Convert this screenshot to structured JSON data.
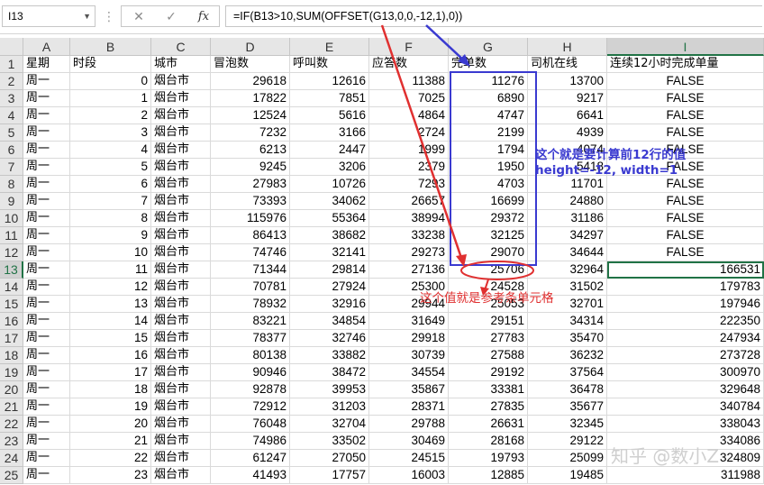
{
  "formula_bar": {
    "name_box": "I13",
    "cancel_glyph": "✕",
    "enter_glyph": "✓",
    "fx_label": "fx",
    "formula": "=IF(B13>10,SUM(OFFSET(G13,0,0,-12,1),0))"
  },
  "columns": [
    "A",
    "B",
    "C",
    "D",
    "E",
    "F",
    "G",
    "H",
    "I"
  ],
  "selected_column": "I",
  "header_row": [
    "星期",
    "时段",
    "城市",
    "冒泡数",
    "呼叫数",
    "应答数",
    "完单数",
    "司机在线",
    "连续12小时完成单量"
  ],
  "rows": [
    [
      "周一",
      "0",
      "烟台市",
      "29618",
      "12616",
      "11388",
      "11276",
      "13700",
      "FALSE"
    ],
    [
      "周一",
      "1",
      "烟台市",
      "17822",
      "7851",
      "7025",
      "6890",
      "9217",
      "FALSE"
    ],
    [
      "周一",
      "2",
      "烟台市",
      "12524",
      "5616",
      "4864",
      "4747",
      "6641",
      "FALSE"
    ],
    [
      "周一",
      "3",
      "烟台市",
      "7232",
      "3166",
      "2724",
      "2199",
      "4939",
      "FALSE"
    ],
    [
      "周一",
      "4",
      "烟台市",
      "6213",
      "2447",
      "1999",
      "1794",
      "4074",
      "FALSE"
    ],
    [
      "周一",
      "5",
      "烟台市",
      "9245",
      "3206",
      "2379",
      "1950",
      "5418",
      "FALSE"
    ],
    [
      "周一",
      "6",
      "烟台市",
      "27983",
      "10726",
      "7293",
      "4703",
      "11701",
      "FALSE"
    ],
    [
      "周一",
      "7",
      "烟台市",
      "73393",
      "34062",
      "26657",
      "16699",
      "24880",
      "FALSE"
    ],
    [
      "周一",
      "8",
      "烟台市",
      "115976",
      "55364",
      "38994",
      "29372",
      "31186",
      "FALSE"
    ],
    [
      "周一",
      "9",
      "烟台市",
      "86413",
      "38682",
      "33238",
      "32125",
      "34297",
      "FALSE"
    ],
    [
      "周一",
      "10",
      "烟台市",
      "74746",
      "32141",
      "29273",
      "29070",
      "34644",
      "FALSE"
    ],
    [
      "周一",
      "11",
      "烟台市",
      "71344",
      "29814",
      "27136",
      "25706",
      "32964",
      "166531"
    ],
    [
      "周一",
      "12",
      "烟台市",
      "70781",
      "27924",
      "25300",
      "24528",
      "31502",
      "179783"
    ],
    [
      "周一",
      "13",
      "烟台市",
      "78932",
      "32916",
      "29944",
      "25053",
      "32701",
      "197946"
    ],
    [
      "周一",
      "14",
      "烟台市",
      "83221",
      "34854",
      "31649",
      "29151",
      "34314",
      "222350"
    ],
    [
      "周一",
      "15",
      "烟台市",
      "78377",
      "32746",
      "29918",
      "27783",
      "35470",
      "247934"
    ],
    [
      "周一",
      "16",
      "烟台市",
      "80138",
      "33882",
      "30739",
      "27588",
      "36232",
      "273728"
    ],
    [
      "周一",
      "17",
      "烟台市",
      "90946",
      "38472",
      "34554",
      "29192",
      "37564",
      "300970"
    ],
    [
      "周一",
      "18",
      "烟台市",
      "92878",
      "39953",
      "35867",
      "33381",
      "36478",
      "329648"
    ],
    [
      "周一",
      "19",
      "烟台市",
      "72912",
      "31203",
      "28371",
      "27835",
      "35677",
      "340784"
    ],
    [
      "周一",
      "20",
      "烟台市",
      "76048",
      "32704",
      "29788",
      "26631",
      "32345",
      "338043"
    ],
    [
      "周一",
      "21",
      "烟台市",
      "74986",
      "33502",
      "30469",
      "28168",
      "29122",
      "334086"
    ],
    [
      "周一",
      "22",
      "烟台市",
      "61247",
      "27050",
      "24515",
      "19793",
      "25099",
      "324809"
    ],
    [
      "周一",
      "23",
      "烟台市",
      "41493",
      "17757",
      "16003",
      "12885",
      "19485",
      "311988"
    ]
  ],
  "active_cell": "I13",
  "annotations": {
    "blue_note_line1": "这个就是要计算前12行的值",
    "blue_note_line2": "height=-12, width=1",
    "red_note": "这个值就是参考条单元格"
  },
  "watermark": "知乎 @数小Z",
  "colors": {
    "blue": "#3a3ad0",
    "red": "#e03030",
    "excel_green": "#217346"
  }
}
